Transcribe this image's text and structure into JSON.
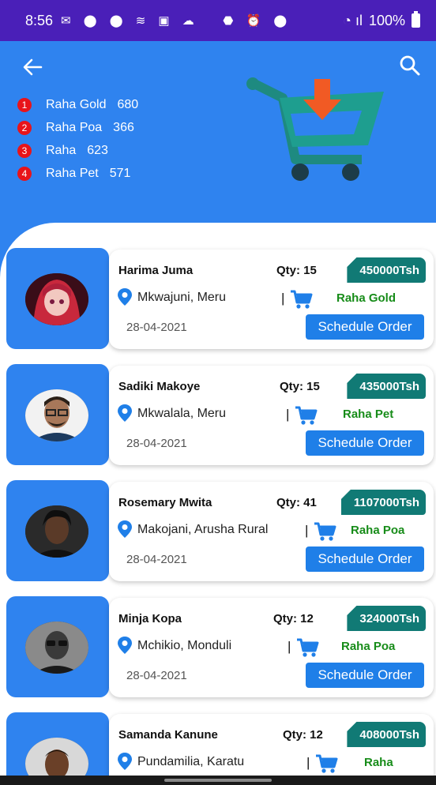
{
  "status_bar": {
    "time": "8:56",
    "battery": "100%"
  },
  "colors": {
    "header": "#2f83ef",
    "status_bar": "#4a1fb8",
    "price_tag": "#117a75",
    "product_text": "#178c19",
    "rank_badge": "#e8141a",
    "button": "#1f7fe8"
  },
  "summary": [
    {
      "rank": "1",
      "name": "Raha Gold",
      "count": "680"
    },
    {
      "rank": "2",
      "name": "Raha Poa",
      "count": "366"
    },
    {
      "rank": "3",
      "name": "Raha",
      "count": "623"
    },
    {
      "rank": "4",
      "name": "Raha Pet",
      "count": "571"
    }
  ],
  "orders": [
    {
      "name": "Harima Juma",
      "qty": "Qty: 15",
      "price": "450000Tsh",
      "location": "Mkwajuni, Meru",
      "product": "Raha Gold",
      "date": "28-04-2021",
      "button": "Schedule Order"
    },
    {
      "name": "Sadiki Makoye",
      "qty": "Qty: 15",
      "price": "435000Tsh",
      "location": "Mkwalala, Meru",
      "product": "Raha Pet",
      "date": "28-04-2021",
      "button": "Schedule Order"
    },
    {
      "name": "Rosemary Mwita",
      "qty": "Qty: 41",
      "price": "1107000Tsh",
      "location": "Makojani, Arusha Rural",
      "product": "Raha Poa",
      "date": "28-04-2021",
      "button": "Schedule Order"
    },
    {
      "name": "Minja Kopa",
      "qty": "Qty: 12",
      "price": "324000Tsh",
      "location": "Mchikio, Monduli",
      "product": "Raha Poa",
      "date": "28-04-2021",
      "button": "Schedule Order"
    },
    {
      "name": "Samanda Kanune",
      "qty": "Qty: 12",
      "price": "408000Tsh",
      "location": "Pundamilia, Karatu",
      "product": "Raha",
      "date": "",
      "button": ""
    }
  ]
}
